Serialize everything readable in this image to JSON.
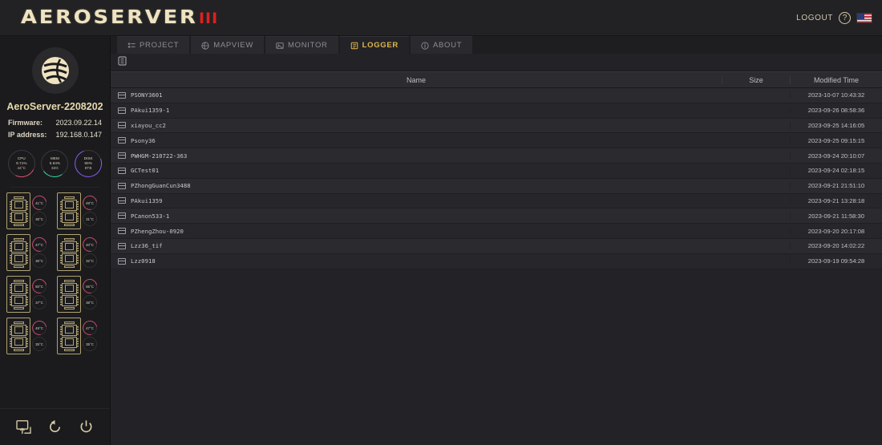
{
  "header": {
    "logo_text": "AEROSERVER",
    "logo_mark": "III",
    "logout_label": "LOGOUT",
    "help_icon": "question-circle-icon",
    "flag_icon": "us-flag-icon"
  },
  "sidebar": {
    "avatar_icon": "globe-swirl-logo",
    "server_name": "AeroServer-2208202",
    "info": [
      {
        "key": "Firmware:",
        "value": "2023.09.22.14"
      },
      {
        "key": "IP address:",
        "value": "192.168.0.147"
      }
    ],
    "gauges": [
      {
        "name": "CPU",
        "label": "CPU",
        "percent": "9.71%",
        "extra": "44°C",
        "color": "#e0506f"
      },
      {
        "name": "MEM",
        "label": "MEM",
        "percent": "5.94%",
        "extra": "32G",
        "color": "#35d6a0"
      },
      {
        "name": "DISK",
        "label": "DISK",
        "percent": "90%",
        "extra": "8TB",
        "color": "#8b5cf6"
      }
    ],
    "cards": [
      {
        "icon": "chip-module-icon",
        "temp_main": "41°C",
        "temp_sub": "35°C"
      },
      {
        "icon": "chip-module-icon",
        "temp_main": "49°C",
        "temp_sub": "31°C"
      },
      {
        "icon": "chip-module-icon",
        "temp_main": "47°C",
        "temp_sub": "36°C"
      },
      {
        "icon": "chip-module-icon",
        "temp_main": "40°C",
        "temp_sub": "32°C"
      },
      {
        "icon": "chip-module-icon",
        "temp_main": "50°C",
        "temp_sub": "37°C"
      },
      {
        "icon": "chip-module-icon",
        "temp_main": "55°C",
        "temp_sub": "38°C"
      },
      {
        "icon": "chip-module-icon",
        "temp_main": "49°C",
        "temp_sub": "35°C"
      },
      {
        "icon": "chip-module-icon",
        "temp_main": "47°C",
        "temp_sub": "35°C"
      }
    ],
    "footer_icons": [
      "export-screen-icon",
      "restart-icon",
      "power-icon"
    ]
  },
  "tabs": [
    {
      "label": "PROJECT",
      "icon": "list-icon",
      "active": false
    },
    {
      "label": "MAPVIEW",
      "icon": "globe-icon",
      "active": false
    },
    {
      "label": "MONITOR",
      "icon": "image-icon",
      "active": false
    },
    {
      "label": "LOGGER",
      "icon": "book-icon",
      "active": true
    },
    {
      "label": "ABOUT",
      "icon": "info-icon",
      "active": false
    }
  ],
  "toolbar": {
    "icon": "log-list-icon"
  },
  "file_table": {
    "columns": [
      "Name",
      "Size",
      "Modified Time"
    ],
    "rows": [
      {
        "name": "PSONY3601",
        "size": "",
        "modified": "2023-10-07 10:43:32"
      },
      {
        "name": "PAkui1359-1",
        "size": "",
        "modified": "2023-09-26 08:58:36"
      },
      {
        "name": "xiayou_cc2",
        "size": "",
        "modified": "2023-09-25 14:16:05"
      },
      {
        "name": "Psony36",
        "size": "",
        "modified": "2023-09-25 09:15:15"
      },
      {
        "name": "PWHGM-210722-363",
        "size": "",
        "modified": "2023-09-24 20:10:07"
      },
      {
        "name": "GCTest01",
        "size": "",
        "modified": "2023-09-24 02:18:15"
      },
      {
        "name": "PZhongGuanCun3488",
        "size": "",
        "modified": "2023-09-21 21:51:10"
      },
      {
        "name": "PAkui1359",
        "size": "",
        "modified": "2023-09-21 13:28:18"
      },
      {
        "name": "PCanon533-1",
        "size": "",
        "modified": "2023-09-21 11:58:30"
      },
      {
        "name": "PZhengZhou-0920",
        "size": "",
        "modified": "2023-09-20 20:17:08"
      },
      {
        "name": "Lzz36_tif",
        "size": "",
        "modified": "2023-09-20 14:02:22"
      },
      {
        "name": "Lzz0918",
        "size": "",
        "modified": "2023-09-19 09:54:28"
      }
    ]
  },
  "colors": {
    "accent_gold": "#e3b84b",
    "logo_cream": "#efe3c0",
    "logo_red": "#e02020",
    "panel_bg": "#232327",
    "row_bg": "#2a2a2f"
  }
}
